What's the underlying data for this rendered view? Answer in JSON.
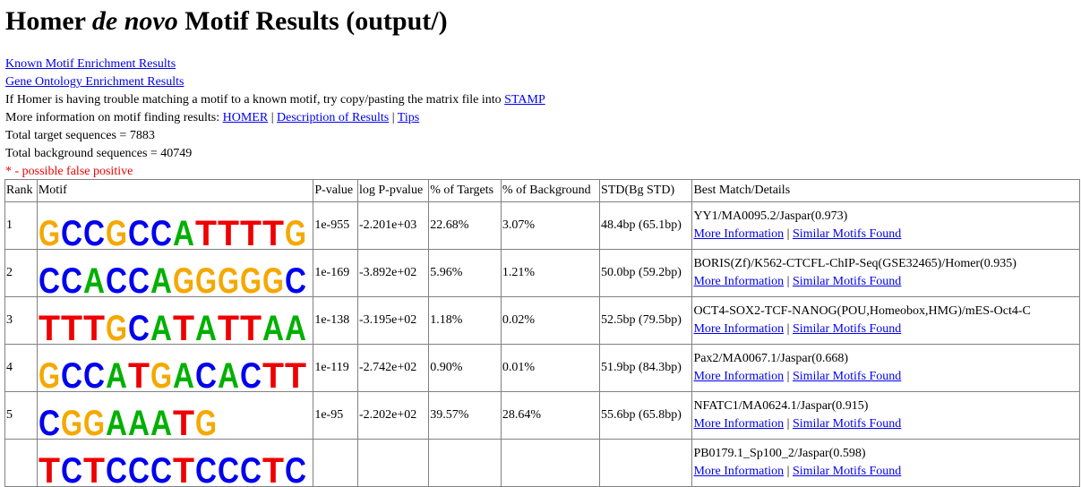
{
  "title": {
    "prefix": "Homer ",
    "italic": "de novo",
    "suffix": " Motif Results (output/)"
  },
  "links": {
    "known": "Known Motif Enrichment Results",
    "go": "Gene Ontology Enrichment Results"
  },
  "stamp_line": {
    "text": "If Homer is having trouble matching a motif to a known motif, try copy/pasting the matrix file into ",
    "link": "STAMP"
  },
  "info_line": {
    "text": "More information on motif finding results: ",
    "homer": "HOMER",
    "sep": " | ",
    "desc": "Description of Results",
    "tips": "Tips"
  },
  "totals": {
    "target": "Total target sequences = 7883",
    "background": "Total background sequences = 40749"
  },
  "false_positive": "* - possible false positive",
  "table": {
    "headers": [
      "Rank",
      "Motif",
      "P-value",
      "log P-pvalue",
      "% of Targets",
      "% of Background",
      "STD(Bg STD)",
      "Best Match/Details"
    ],
    "more_info": "More Information",
    "similar": "Similar Motifs Found",
    "sep": " | ",
    "rows": [
      {
        "rank": "1",
        "motif": "GCCGCCATTTTG",
        "pvalue": "1e-955",
        "logp": "-2.201e+03",
        "targets": "22.68%",
        "background": "3.07%",
        "std": "48.4bp (65.1bp)",
        "match": "YY1/MA0095.2/Jaspar(0.973)"
      },
      {
        "rank": "2",
        "motif": "CCACCAGGGGGC",
        "pvalue": "1e-169",
        "logp": "-3.892e+02",
        "targets": "5.96%",
        "background": "1.21%",
        "std": "50.0bp (59.2bp)",
        "match": "BORIS(Zf)/K562-CTCFL-ChIP-Seq(GSE32465)/Homer(0.935)"
      },
      {
        "rank": "3",
        "motif": "TTTGCATATTAA",
        "pvalue": "1e-138",
        "logp": "-3.195e+02",
        "targets": "1.18%",
        "background": "0.02%",
        "std": "52.5bp (79.5bp)",
        "match": "OCT4-SOX2-TCF-NANOG(POU,Homeobox,HMG)/mES-Oct4-C"
      },
      {
        "rank": "4",
        "motif": "GCCATGACACTT",
        "pvalue": "1e-119",
        "logp": "-2.742e+02",
        "targets": "0.90%",
        "background": "0.01%",
        "std": "51.9bp (84.3bp)",
        "match": "Pax2/MA0067.1/Jaspar(0.668)"
      },
      {
        "rank": "5",
        "motif": "CGGAAATG",
        "pvalue": "1e-95",
        "logp": "-2.202e+02",
        "targets": "39.57%",
        "background": "28.64%",
        "std": "55.6bp (65.8bp)",
        "match": "NFATC1/MA0624.1/Jaspar(0.915)"
      },
      {
        "rank": "",
        "motif": "TCTCCCTCCCTC",
        "pvalue": "",
        "logp": "",
        "targets": "",
        "background": "",
        "std": "",
        "match": "PB0179.1_Sp100_2/Jaspar(0.598)"
      }
    ]
  },
  "colors": {
    "A": "#00b000",
    "C": "#0000ee",
    "G": "#f5a800",
    "T": "#ee0000",
    "link": "#0000ee",
    "warning": "#ee0000"
  }
}
